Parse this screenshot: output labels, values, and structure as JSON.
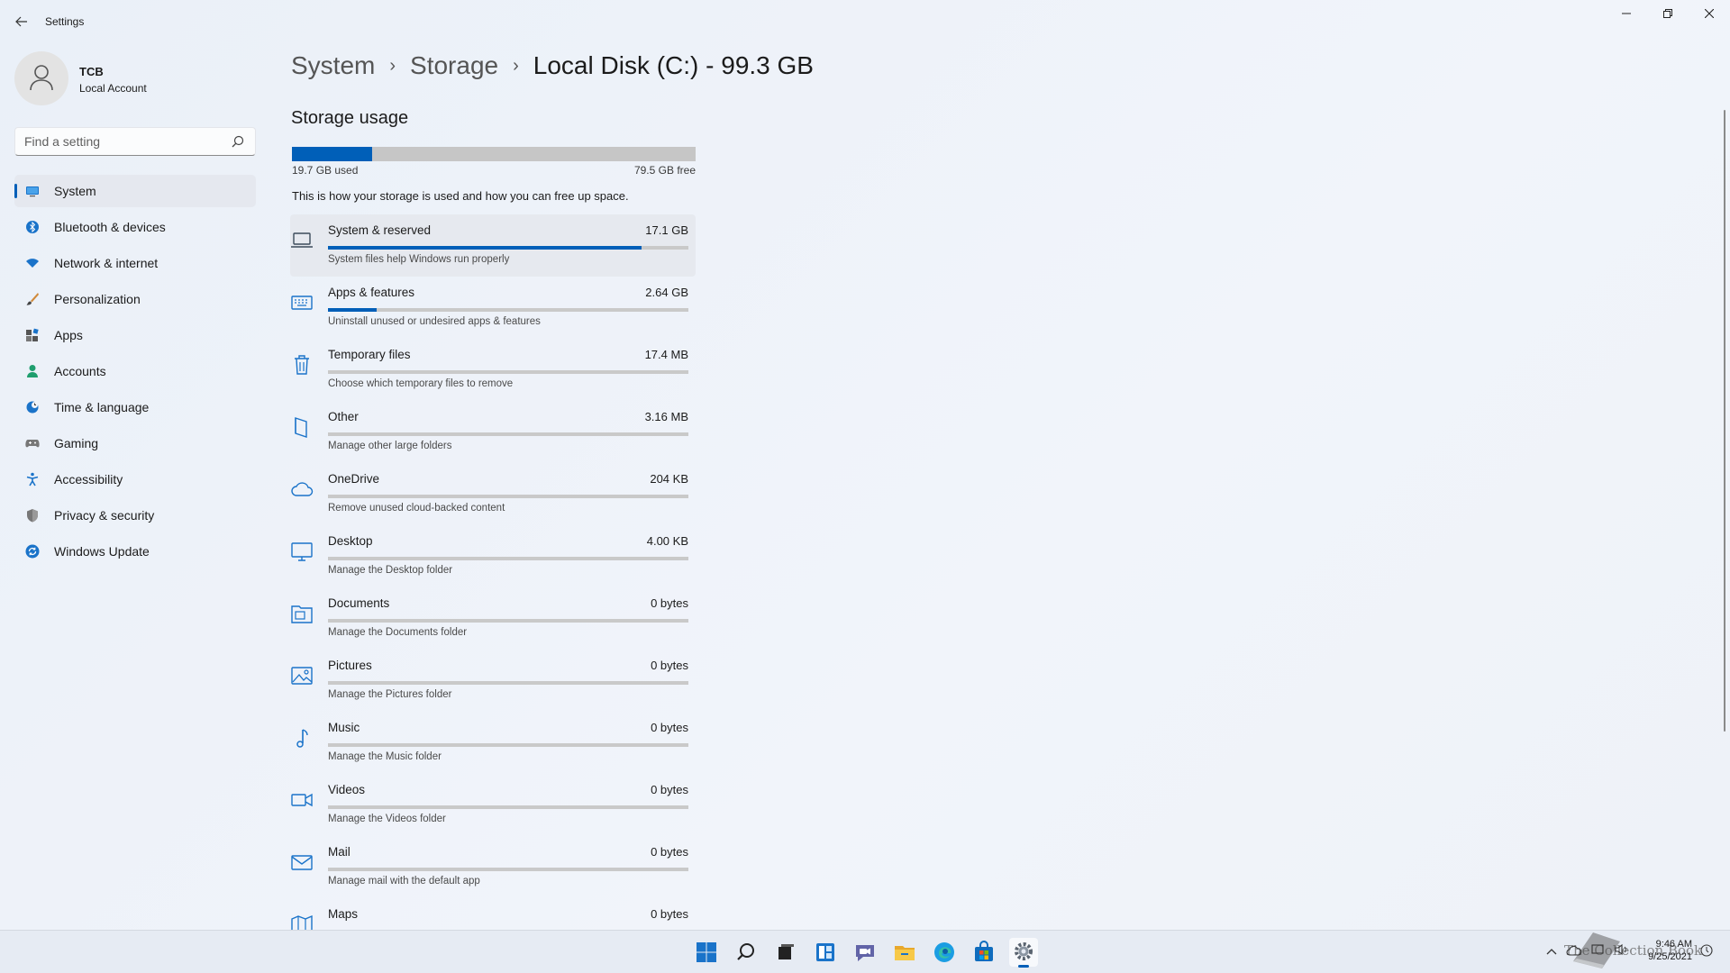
{
  "window": {
    "title": "Settings"
  },
  "profile": {
    "name": "TCB",
    "account_type": "Local Account"
  },
  "search": {
    "placeholder": "Find a setting"
  },
  "nav": {
    "items": [
      {
        "label": "System",
        "icon": "monitor-icon",
        "selected": true
      },
      {
        "label": "Bluetooth & devices",
        "icon": "bluetooth-icon"
      },
      {
        "label": "Network & internet",
        "icon": "wifi-icon"
      },
      {
        "label": "Personalization",
        "icon": "brush-icon"
      },
      {
        "label": "Apps",
        "icon": "apps-icon"
      },
      {
        "label": "Accounts",
        "icon": "person-icon"
      },
      {
        "label": "Time & language",
        "icon": "globe-clock-icon"
      },
      {
        "label": "Gaming",
        "icon": "gamepad-icon"
      },
      {
        "label": "Accessibility",
        "icon": "accessibility-icon"
      },
      {
        "label": "Privacy & security",
        "icon": "shield-icon"
      },
      {
        "label": "Windows Update",
        "icon": "update-icon"
      }
    ]
  },
  "breadcrumb": {
    "parts": [
      "System",
      "Storage"
    ],
    "current": "Local Disk (C:) - 99.3 GB",
    "separator": "›"
  },
  "storage": {
    "section_title": "Storage usage",
    "used_label": "19.7 GB used",
    "free_label": "79.5 GB free",
    "used_fraction": 0.198,
    "description": "This is how your storage is used and how you can free up space.",
    "categories": [
      {
        "name": "System & reserved",
        "size": "17.1 GB",
        "desc": "System files help Windows run properly",
        "icon": "laptop-icon",
        "fraction": 0.87
      },
      {
        "name": "Apps & features",
        "size": "2.64 GB",
        "desc": "Uninstall unused or undesired apps & features",
        "icon": "keyboard-icon",
        "fraction": 0.134
      },
      {
        "name": "Temporary files",
        "size": "17.4 MB",
        "desc": "Choose which temporary files to remove",
        "icon": "trash-icon",
        "fraction": 0
      },
      {
        "name": "Other",
        "size": "3.16 MB",
        "desc": "Manage other large folders",
        "icon": "book-icon",
        "fraction": 0
      },
      {
        "name": "OneDrive",
        "size": "204 KB",
        "desc": "Remove unused cloud-backed content",
        "icon": "cloud-icon",
        "fraction": 0
      },
      {
        "name": "Desktop",
        "size": "4.00 KB",
        "desc": "Manage the Desktop folder",
        "icon": "desktop-icon",
        "fraction": 0
      },
      {
        "name": "Documents",
        "size": "0 bytes",
        "desc": "Manage the Documents folder",
        "icon": "documents-folder-icon",
        "fraction": 0
      },
      {
        "name": "Pictures",
        "size": "0 bytes",
        "desc": "Manage the Pictures folder",
        "icon": "picture-icon",
        "fraction": 0
      },
      {
        "name": "Music",
        "size": "0 bytes",
        "desc": "Manage the Music folder",
        "icon": "music-note-icon",
        "fraction": 0
      },
      {
        "name": "Videos",
        "size": "0 bytes",
        "desc": "Manage the Videos folder",
        "icon": "video-camera-icon",
        "fraction": 0
      },
      {
        "name": "Mail",
        "size": "0 bytes",
        "desc": "Manage mail with the default app",
        "icon": "mail-icon",
        "fraction": 0
      },
      {
        "name": "Maps",
        "size": "0 bytes",
        "desc": "",
        "icon": "map-icon",
        "fraction": 0
      }
    ]
  },
  "taskbar": {
    "apps": [
      "start-icon",
      "search-icon",
      "task-view-icon",
      "widgets-icon",
      "chat-icon",
      "file-explorer-icon",
      "edge-icon",
      "store-icon",
      "settings-icon"
    ],
    "active_app": "settings-icon",
    "watermark_text": "The Collection Book",
    "clock": {
      "time": "9:46 AM",
      "date": "9/25/2021"
    }
  },
  "colors": {
    "accent": "#005fb8",
    "bar_track": "#c6c6c6"
  }
}
